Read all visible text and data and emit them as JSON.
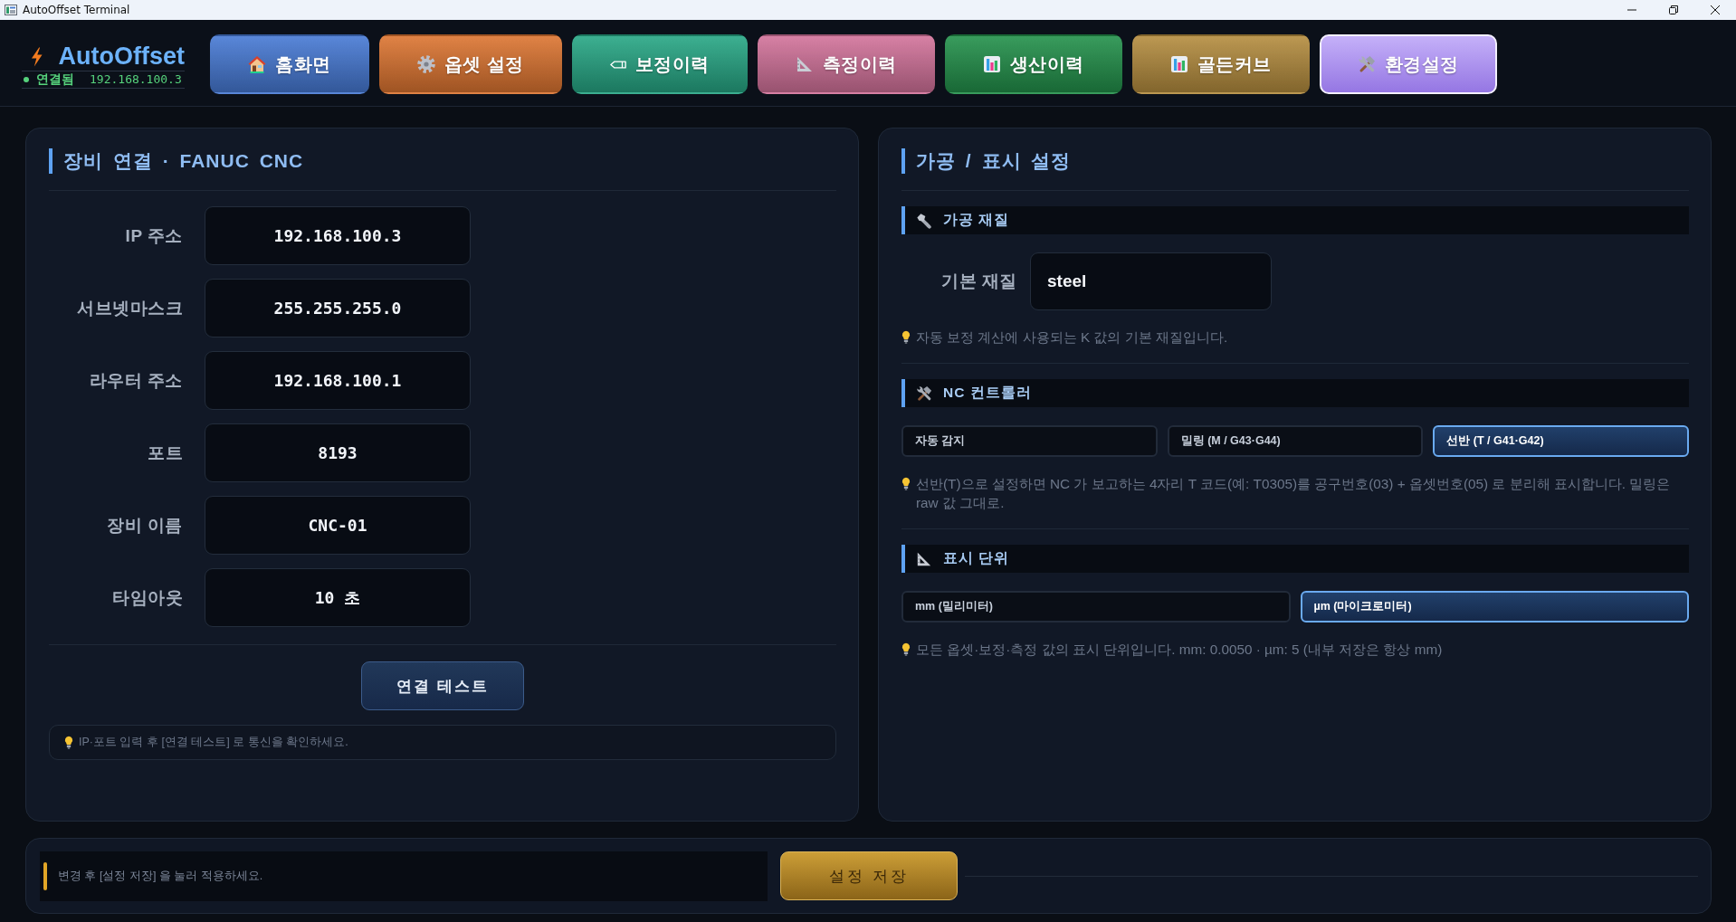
{
  "window": {
    "title": "AutoOffset Terminal"
  },
  "header": {
    "logo": "AutoOffset",
    "status": {
      "connected": true,
      "label": "연결됨",
      "ip": "192.168.100.3"
    }
  },
  "nav": [
    {
      "label": "홈화면",
      "color": "#4679d4",
      "selected": false
    },
    {
      "label": "옵셋 설정",
      "color": "#dc7430",
      "selected": false
    },
    {
      "label": "보정이력",
      "color": "#26a684",
      "selected": false
    },
    {
      "label": "측정이력",
      "color": "#d2729a",
      "selected": false
    },
    {
      "label": "생산이력",
      "color": "#22904a",
      "selected": false
    },
    {
      "label": "골든커브",
      "color": "#b48c3e",
      "selected": false
    },
    {
      "label": "환경설정",
      "color": "#ae92f6",
      "selected": true
    }
  ],
  "connection_panel": {
    "title": "장비 연결 · FANUC CNC",
    "fields": [
      {
        "label": "IP 주소",
        "value": "192.168.100.3"
      },
      {
        "label": "서브넷마스크",
        "value": "255.255.255.0"
      },
      {
        "label": "라우터 주소",
        "value": "192.168.100.1"
      },
      {
        "label": "포트",
        "value": "8193"
      },
      {
        "label": "장비 이름",
        "value": "CNC-01"
      },
      {
        "label": "타임아웃",
        "value": "10 초"
      }
    ],
    "test_button": "연결 테스트",
    "hint": "IP·포트 입력 후 [연결 테스트] 로 통신을 확인하세요."
  },
  "machining_panel": {
    "title": "가공 / 표시 설정",
    "sections": [
      {
        "kind": "field",
        "heading": "가공 재질",
        "field": {
          "label": "기본 재질",
          "value": "steel"
        },
        "hint": "자동 보정 계산에 사용되는 K 값의 기본 재질입니다."
      },
      {
        "kind": "choice",
        "heading": "NC 컨트롤러",
        "options": [
          {
            "label": "자동 감지",
            "selected": false
          },
          {
            "label": "밀링 (M / G43·G44)",
            "selected": false
          },
          {
            "label": "선반 (T / G41·G42)",
            "selected": true
          }
        ],
        "hint": "선반(T)으로 설정하면 NC 가 보고하는 4자리 T 코드(예: T0305)를 공구번호(03) + 옵셋번호(05) 로 분리해 표시합니다. 밀링은 raw 값 그대로."
      },
      {
        "kind": "choice",
        "heading": "표시 단위",
        "options": [
          {
            "label": "mm (밀리미터)",
            "selected": false
          },
          {
            "label": "µm (마이크로미터)",
            "selected": true
          }
        ],
        "hint": "모든 옵셋·보정·측정 값의 표시 단위입니다. mm: 0.0050 · µm: 5 (내부 저장은 항상 mm)"
      }
    ]
  },
  "footer": {
    "message": "변경 후 [설정 저장] 을 눌러 적용하세요.",
    "save_button": "설정 저장"
  }
}
